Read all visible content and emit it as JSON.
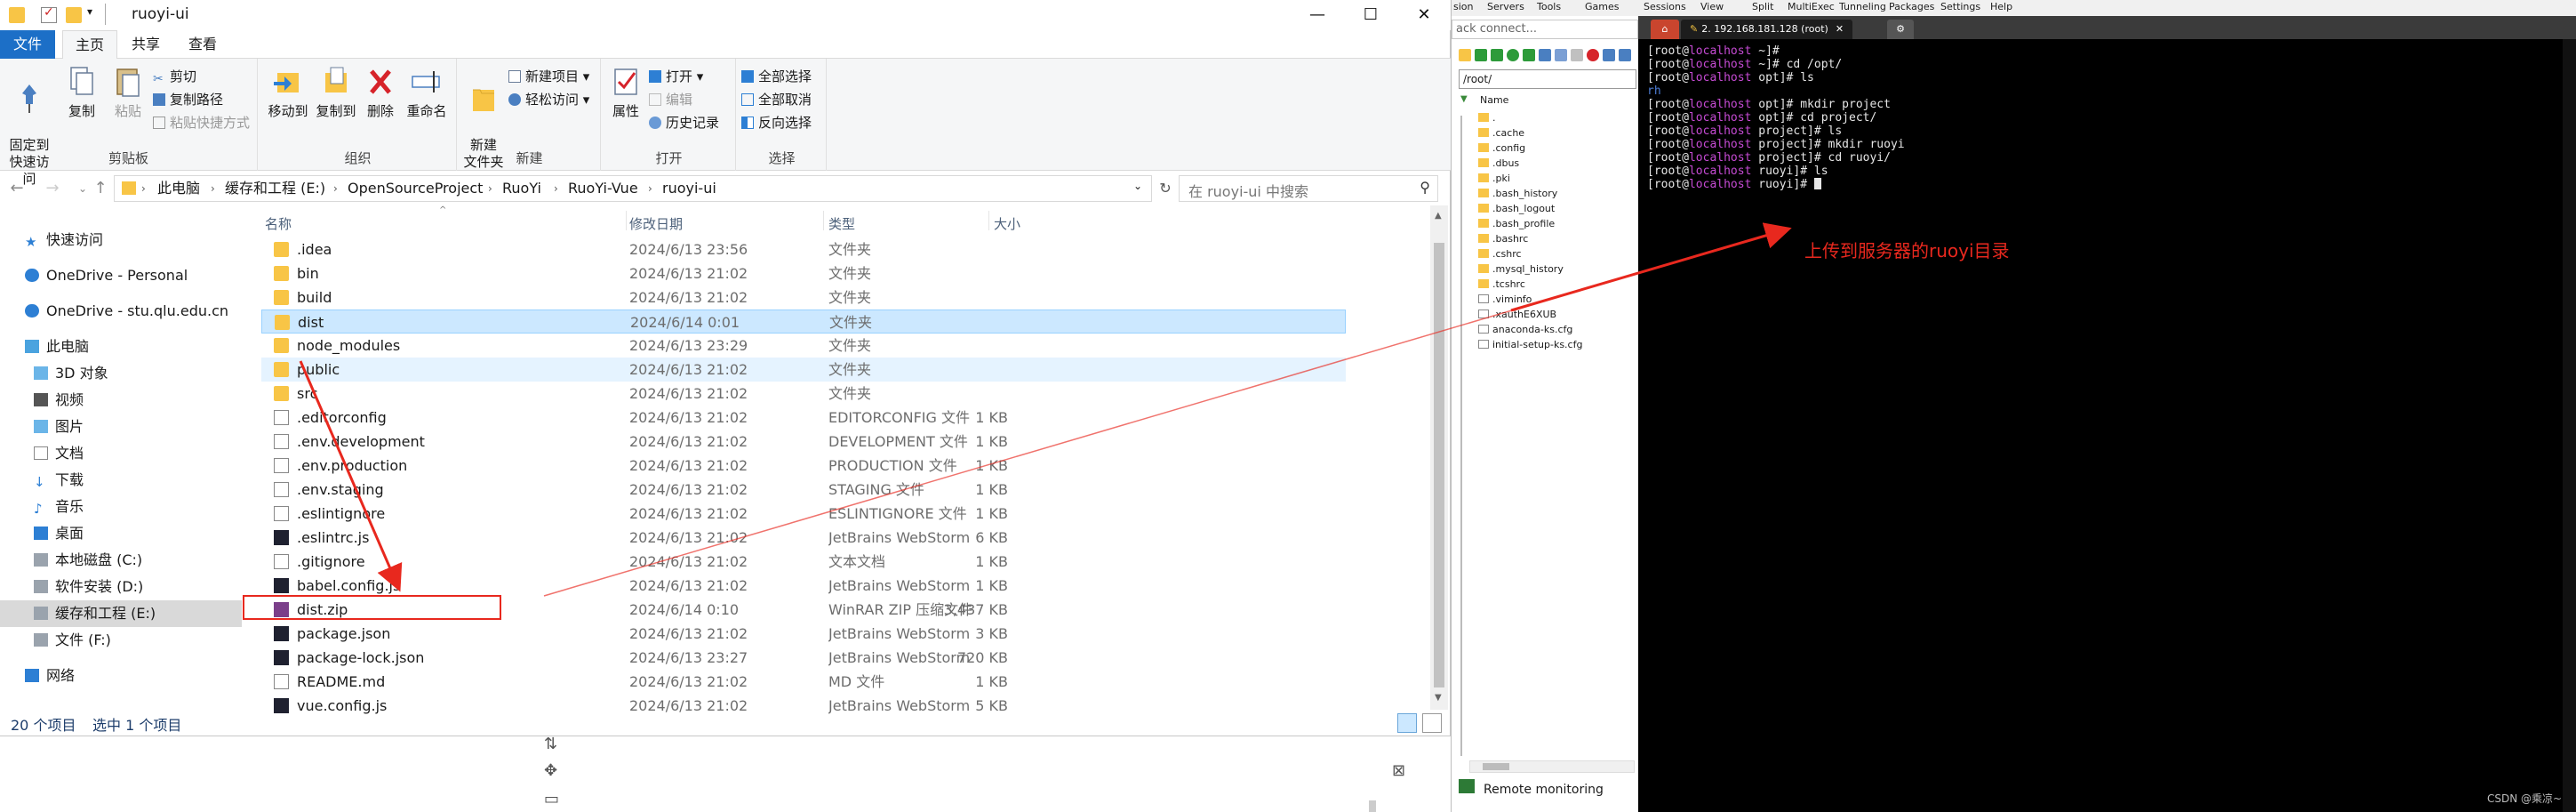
{
  "window": {
    "title": "ruoyi-ui",
    "controls": {
      "minimize": "—",
      "maximize": "☐",
      "close": "✕"
    }
  },
  "ribbon": {
    "tabs": [
      "文件",
      "主页",
      "共享",
      "查看"
    ],
    "groups": {
      "clipboard": {
        "label": "剪贴板",
        "pin": "固定到\n快速访问",
        "copy": "复制",
        "paste": "粘贴",
        "cut": "剪切",
        "copy_path": "复制路径",
        "paste_shortcut": "粘贴快捷方式"
      },
      "organize": {
        "label": "组织",
        "move_to": "移动到",
        "copy_to": "复制到",
        "delete": "删除",
        "rename": "重命名"
      },
      "new": {
        "label": "新建",
        "new_folder": "新建\n文件夹",
        "new_item": "新建项目",
        "easy_access": "轻松访问"
      },
      "open": {
        "label": "打开",
        "properties": "属性",
        "open": "打开",
        "edit": "编辑",
        "history": "历史记录"
      },
      "select": {
        "label": "选择",
        "select_all": "全部选择",
        "select_none": "全部取消",
        "invert": "反向选择"
      }
    }
  },
  "address": {
    "crumbs": [
      "此电脑",
      "缓存和工程 (E:)",
      "OpenSourceProject",
      "RuoYi",
      "RuoYi-Vue",
      "ruoyi-ui"
    ],
    "search_placeholder": "在 ruoyi-ui 中搜索"
  },
  "nav": {
    "items": [
      {
        "label": "快速访问"
      },
      {
        "label": "OneDrive - Personal"
      },
      {
        "label": "OneDrive - stu.qlu.edu.cn"
      },
      {
        "label": "此电脑"
      },
      {
        "label": "3D 对象"
      },
      {
        "label": "视频"
      },
      {
        "label": "图片"
      },
      {
        "label": "文档"
      },
      {
        "label": "下载"
      },
      {
        "label": "音乐"
      },
      {
        "label": "桌面"
      },
      {
        "label": "本地磁盘 (C:)"
      },
      {
        "label": "软件安装 (D:)"
      },
      {
        "label": "缓存和工程 (E:)"
      },
      {
        "label": "文件 (F:)"
      },
      {
        "label": "网络"
      }
    ]
  },
  "files": {
    "columns": {
      "name": "名称",
      "modified": "修改日期",
      "type": "类型",
      "size": "大小"
    },
    "rows": [
      {
        "name": ".idea",
        "modified": "2024/6/13 23:56",
        "type": "文件夹",
        "size": "",
        "icon": "folder"
      },
      {
        "name": "bin",
        "modified": "2024/6/13 21:02",
        "type": "文件夹",
        "size": "",
        "icon": "folder"
      },
      {
        "name": "build",
        "modified": "2024/6/13 21:02",
        "type": "文件夹",
        "size": "",
        "icon": "folder"
      },
      {
        "name": "dist",
        "modified": "2024/6/14 0:01",
        "type": "文件夹",
        "size": "",
        "icon": "folder"
      },
      {
        "name": "node_modules",
        "modified": "2024/6/13 23:29",
        "type": "文件夹",
        "size": "",
        "icon": "folder"
      },
      {
        "name": "public",
        "modified": "2024/6/13 21:02",
        "type": "文件夹",
        "size": "",
        "icon": "folder"
      },
      {
        "name": "src",
        "modified": "2024/6/13 21:02",
        "type": "文件夹",
        "size": "",
        "icon": "folder"
      },
      {
        "name": ".editorconfig",
        "modified": "2024/6/13 21:02",
        "type": "EDITORCONFIG 文件",
        "size": "1 KB",
        "icon": "doc"
      },
      {
        "name": ".env.development",
        "modified": "2024/6/13 21:02",
        "type": "DEVELOPMENT 文件",
        "size": "1 KB",
        "icon": "doc"
      },
      {
        "name": ".env.production",
        "modified": "2024/6/13 21:02",
        "type": "PRODUCTION 文件",
        "size": "1 KB",
        "icon": "doc"
      },
      {
        "name": ".env.staging",
        "modified": "2024/6/13 21:02",
        "type": "STAGING 文件",
        "size": "1 KB",
        "icon": "doc"
      },
      {
        "name": ".eslintignore",
        "modified": "2024/6/13 21:02",
        "type": "ESLINTIGNORE 文件",
        "size": "1 KB",
        "icon": "doc"
      },
      {
        "name": ".eslintrc.js",
        "modified": "2024/6/13 21:02",
        "type": "JetBrains WebStorm",
        "size": "6 KB",
        "icon": "ws"
      },
      {
        "name": ".gitignore",
        "modified": "2024/6/13 21:02",
        "type": "文本文档",
        "size": "1 KB",
        "icon": "doc"
      },
      {
        "name": "babel.config.js",
        "modified": "2024/6/13 21:02",
        "type": "JetBrains WebStorm",
        "size": "1 KB",
        "icon": "ws"
      },
      {
        "name": "dist.zip",
        "modified": "2024/6/14 0:10",
        "type": "WinRAR ZIP 压缩文件",
        "size": "3,437 KB",
        "icon": "zip"
      },
      {
        "name": "package.json",
        "modified": "2024/6/13 21:02",
        "type": "JetBrains WebStorm",
        "size": "3 KB",
        "icon": "ws"
      },
      {
        "name": "package-lock.json",
        "modified": "2024/6/13 23:27",
        "type": "JetBrains WebStorm",
        "size": "720 KB",
        "icon": "ws"
      },
      {
        "name": "README.md",
        "modified": "2024/6/13 21:02",
        "type": "MD 文件",
        "size": "1 KB",
        "icon": "doc"
      },
      {
        "name": "vue.config.js",
        "modified": "2024/6/13 21:02",
        "type": "JetBrains WebStorm",
        "size": "5 KB",
        "icon": "ws"
      }
    ]
  },
  "status": {
    "count": "20 个项目",
    "selected": "选中 1 个项目"
  },
  "sftp": {
    "menu": [
      "sion",
      "Servers",
      "Tools",
      "Games",
      "Sessions",
      "View",
      "Split",
      "MultiExec",
      "Tunneling",
      "Packages",
      "Settings",
      "Help"
    ],
    "quick_connect": "ack connect...",
    "path": "/root/",
    "header": "Name",
    "items": [
      ".",
      ".cache",
      ".config",
      ".dbus",
      ".pki",
      ".bash_history",
      ".bash_logout",
      ".bash_profile",
      ".bashrc",
      ".cshrc",
      ".mysql_history",
      ".tcshrc",
      ".viminfo",
      ".xauthE6XUB",
      "anaconda-ks.cfg",
      "initial-setup-ks.cfg"
    ],
    "remote_tab": "Remote monitoring"
  },
  "terminal": {
    "tab_title": "2. 192.168.181.128 (root)",
    "lines": [
      {
        "prompt": "[root@",
        "host": "localhost",
        "path": " ~]# ",
        "cmd": ""
      },
      {
        "prompt": "[root@",
        "host": "localhost",
        "path": " ~]# ",
        "cmd": "cd /opt/"
      },
      {
        "prompt": "[root@",
        "host": "localhost",
        "path": " opt]# ",
        "cmd": "ls"
      },
      {
        "prompt": "",
        "host": "",
        "path": "",
        "cmd": "rh"
      },
      {
        "prompt": "[root@",
        "host": "localhost",
        "path": " opt]# ",
        "cmd": "mkdir project"
      },
      {
        "prompt": "[root@",
        "host": "localhost",
        "path": " opt]# ",
        "cmd": "cd project/"
      },
      {
        "prompt": "[root@",
        "host": "localhost",
        "path": " project]# ",
        "cmd": "ls"
      },
      {
        "prompt": "[root@",
        "host": "localhost",
        "path": " project]# ",
        "cmd": "mkdir ruoyi"
      },
      {
        "prompt": "[root@",
        "host": "localhost",
        "path": " project]# ",
        "cmd": "cd ruoyi/"
      },
      {
        "prompt": "[root@",
        "host": "localhost",
        "path": " ruoyi]# ",
        "cmd": "ls"
      },
      {
        "prompt": "[root@",
        "host": "localhost",
        "path": " ruoyi]# ",
        "cmd": ""
      }
    ]
  },
  "annotation": {
    "text": "上传到服务器的ruoyi目录",
    "color": "#e8281e"
  },
  "watermark": "CSDN @乘凉~"
}
